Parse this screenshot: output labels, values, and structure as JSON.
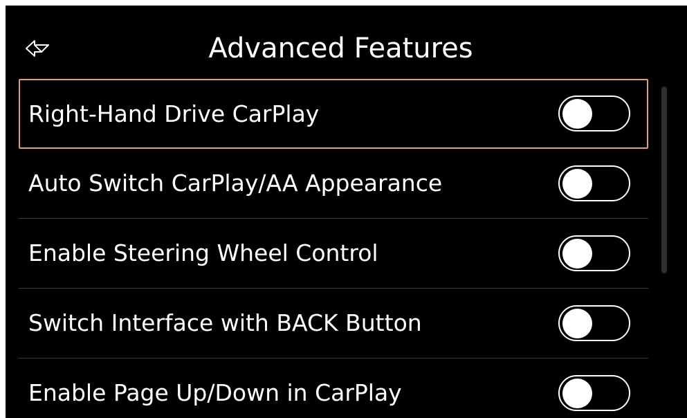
{
  "header": {
    "title": "Advanced Features",
    "back_icon": "back-arrow-icon"
  },
  "settings": {
    "items": [
      {
        "label": "Right-Hand Drive CarPlay",
        "enabled": false,
        "selected": true
      },
      {
        "label": "Auto Switch CarPlay/AA Appearance",
        "enabled": false,
        "selected": false
      },
      {
        "label": "Enable Steering Wheel Control",
        "enabled": false,
        "selected": false
      },
      {
        "label": "Switch Interface with BACK Button",
        "enabled": false,
        "selected": false
      },
      {
        "label": "Enable Page Up/Down in CarPlay",
        "enabled": false,
        "selected": false
      }
    ]
  },
  "colors": {
    "background": "#000000",
    "text": "#ffffff",
    "selection_border": "#e0a070",
    "divider": "#3a3a3a"
  }
}
